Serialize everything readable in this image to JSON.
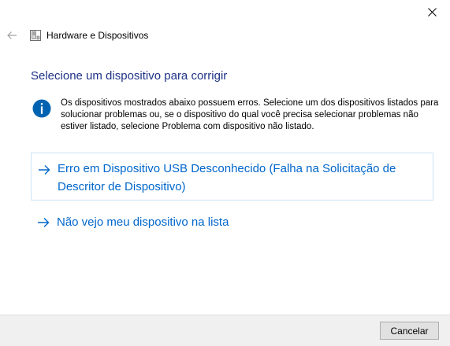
{
  "window": {
    "close_icon": "close-icon"
  },
  "nav": {
    "back_icon": "back-arrow-icon",
    "app_icon": "hardware-devices-icon",
    "title": "Hardware e Dispositivos"
  },
  "main": {
    "heading": "Selecione um dispositivo para corrigir",
    "info_icon": "info-icon",
    "info_text": "Os dispositivos mostrados abaixo possuem erros. Selecione um dos dispositivos listados para solucionar problemas ou, se o dispositivo do qual você precisa selecionar problemas não estiver listado, selecione Problema com dispositivo não listado.",
    "options": [
      {
        "label_line1": "Erro em Dispositivo USB Desconhecido (Falha na Solicitação de",
        "label_line2": "Descritor de Dispositivo)",
        "icon": "arrow-right-icon"
      },
      {
        "label_line1": "Não vejo meu dispositivo na lista",
        "icon": "arrow-right-icon"
      }
    ]
  },
  "footer": {
    "cancel_label": "Cancelar"
  },
  "colors": {
    "heading": "#1e3287",
    "link": "#0066cc",
    "info_icon_bg": "#0063b1",
    "option_border": "#cce4f7",
    "footer_bg": "#f0f0f0"
  }
}
